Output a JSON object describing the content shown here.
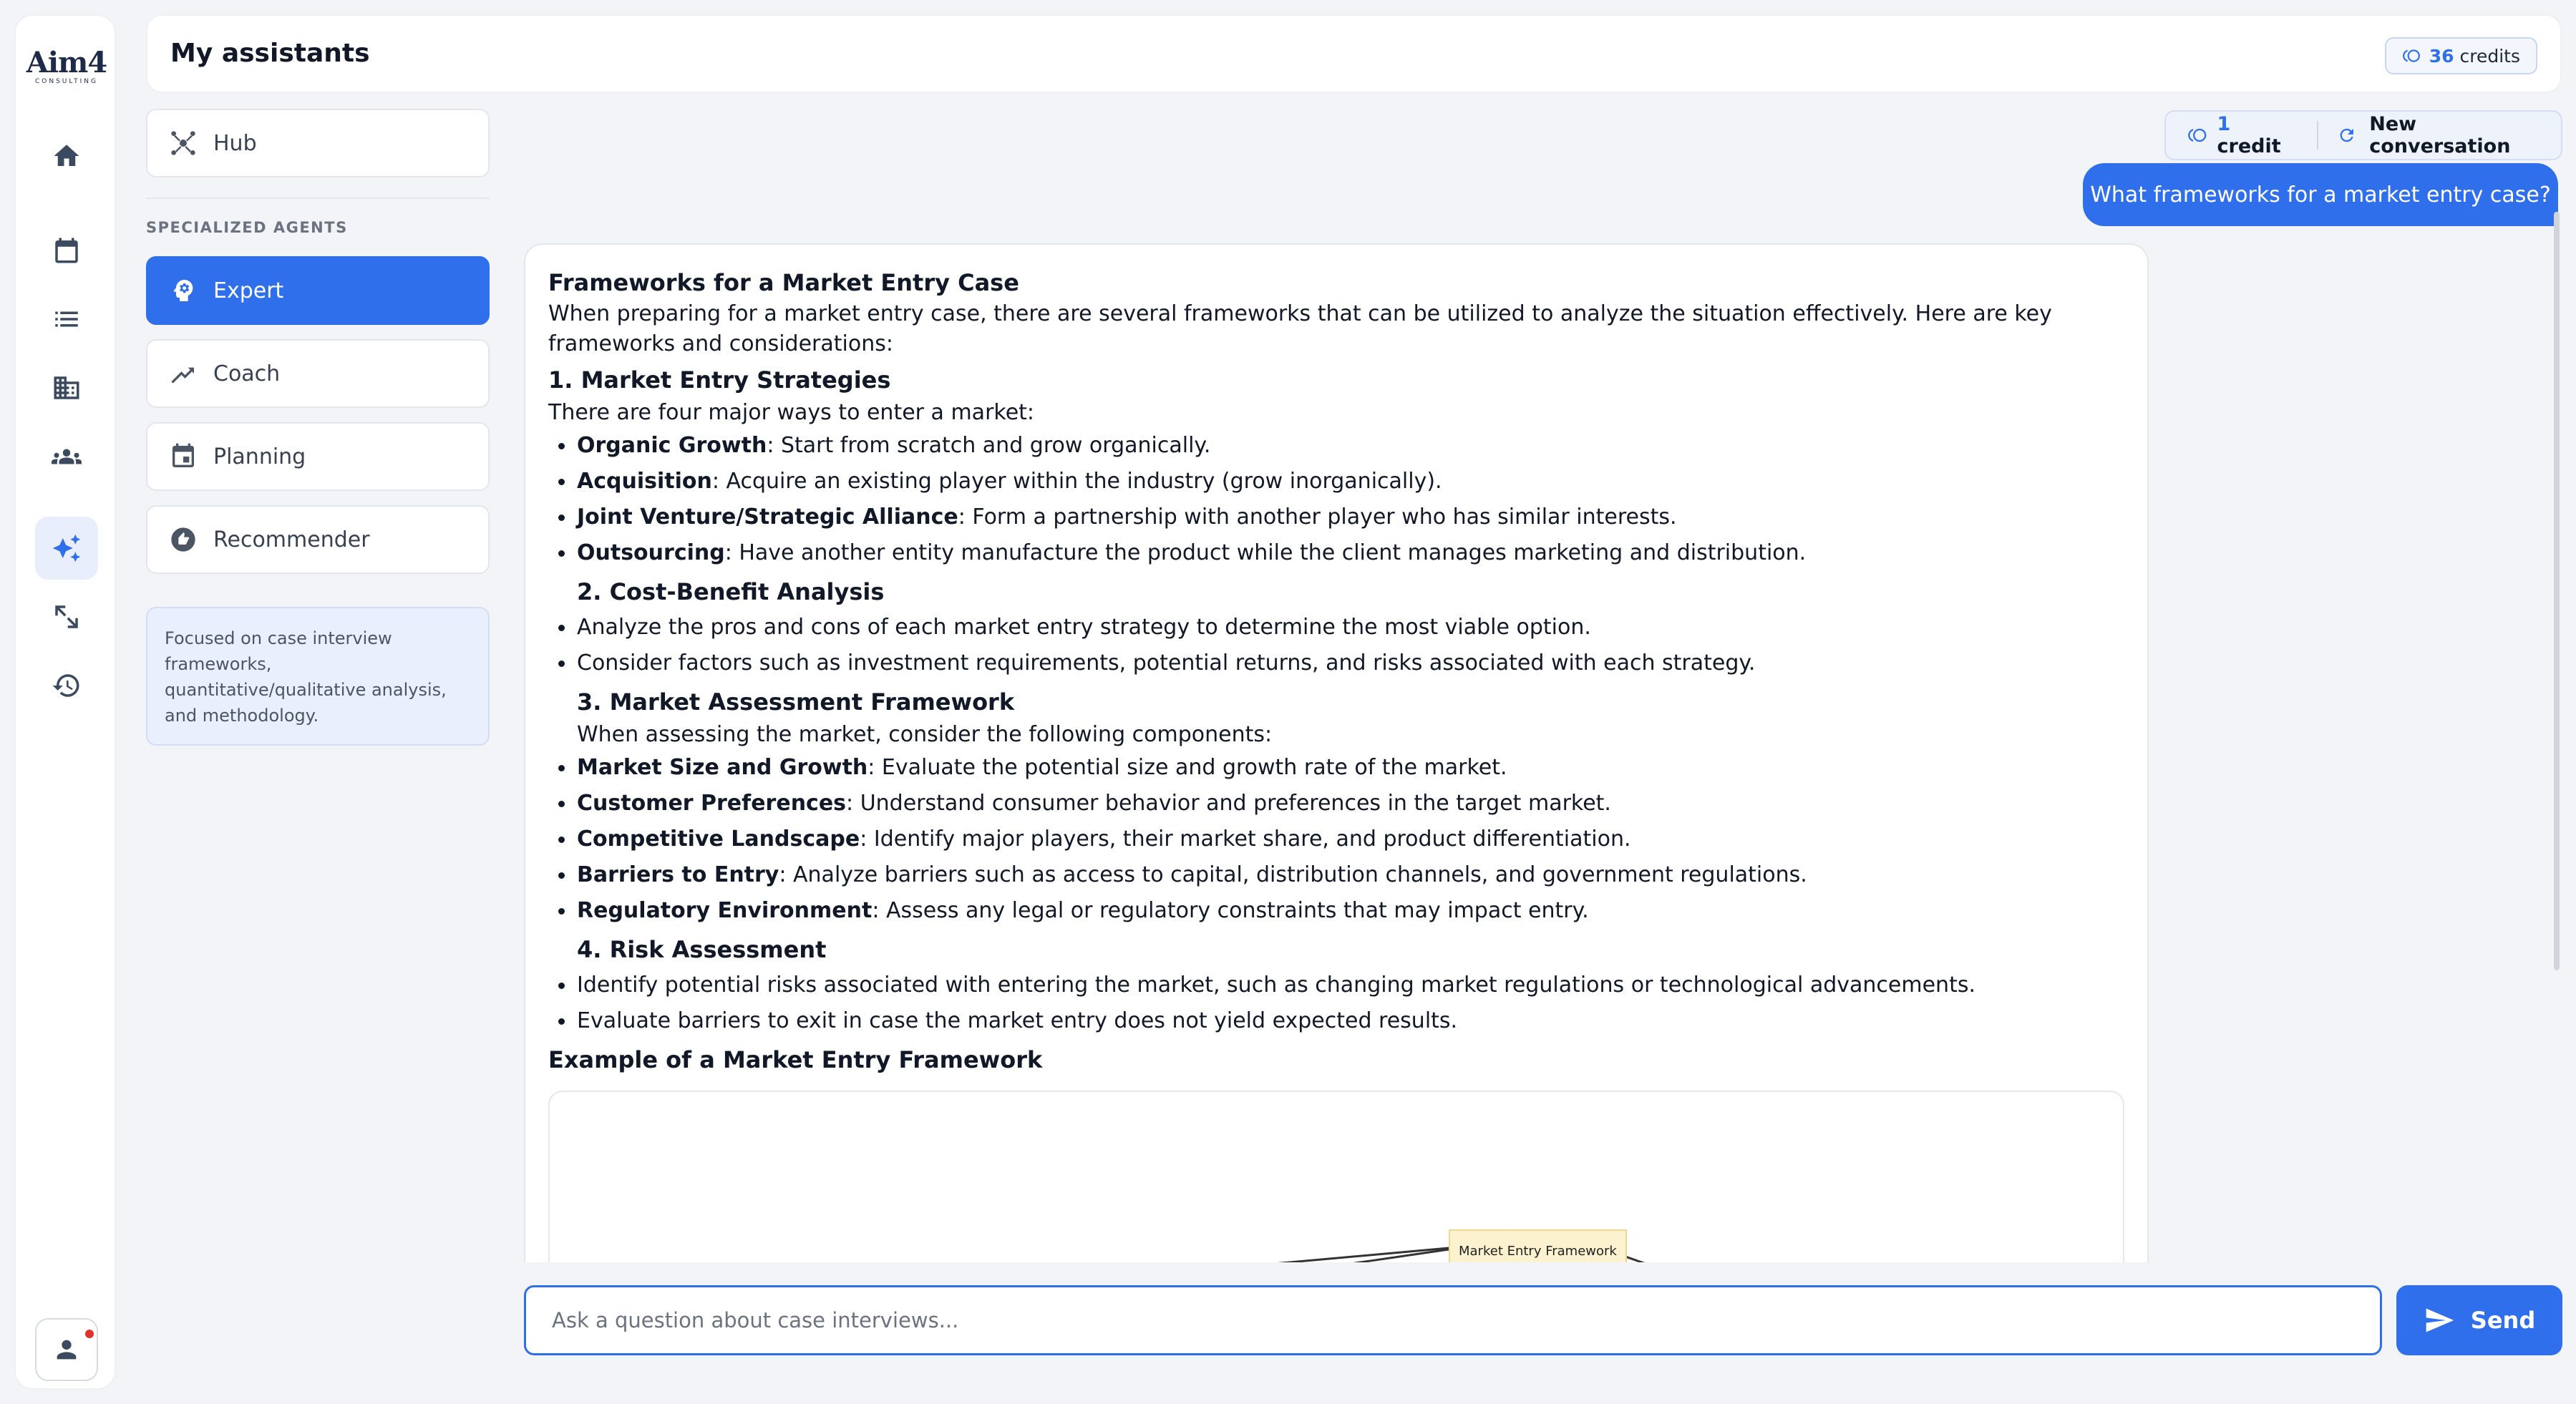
{
  "brand": {
    "logo_text": "Aim4",
    "logo_sub": "CONSULTING"
  },
  "header": {
    "title": "My assistants",
    "credits_value": "36",
    "credits_label": "credits"
  },
  "nav": {
    "items": [
      "home-icon",
      "calendar-icon",
      "list-icon",
      "building-icon",
      "people-icon",
      "sparkle-icon",
      "expand-icon",
      "history-icon"
    ],
    "active": "sparkle-icon"
  },
  "agents": {
    "hub_label": "Hub",
    "section_label": "SPECIALIZED AGENTS",
    "items": [
      {
        "label": "Expert",
        "active": true
      },
      {
        "label": "Coach",
        "active": false
      },
      {
        "label": "Planning",
        "active": false
      },
      {
        "label": "Recommender",
        "active": false
      }
    ],
    "description": "Focused on case interview frameworks, quantitative/qualitative analysis, and methodology."
  },
  "chat": {
    "credit_value": "1",
    "credit_label": "credit",
    "new_conversation": "New conversation",
    "user_message": "What frameworks for a market entry case?",
    "input_placeholder": "Ask a question about case interviews...",
    "send_label": "Send"
  },
  "response": {
    "title": "Frameworks for a Market Entry Case",
    "intro": "When preparing for a market entry case, there are several frameworks that can be utilized to analyze the situation effectively. Here are key frameworks and considerations:",
    "s1_title": "1. Market Entry Strategies",
    "s1_intro": "There are four major ways to enter a market:",
    "s1_items": [
      {
        "bold": "Organic Growth",
        "text": ": Start from scratch and grow organically."
      },
      {
        "bold": "Acquisition",
        "text": ": Acquire an existing player within the industry (grow inorganically)."
      },
      {
        "bold": "Joint Venture/Strategic Alliance",
        "text": ": Form a partnership with another player who has similar interests."
      },
      {
        "bold": "Outsourcing",
        "text": ": Have another entity manufacture the product while the client manages marketing and distribution."
      }
    ],
    "s2_title": "2. Cost-Benefit Analysis",
    "s2_items": [
      "Analyze the pros and cons of each market entry strategy to determine the most viable option.",
      "Consider factors such as investment requirements, potential returns, and risks associated with each strategy."
    ],
    "s3_title": "3. Market Assessment Framework",
    "s3_intro": "When assessing the market, consider the following components:",
    "s3_items": [
      {
        "bold": "Market Size and Growth",
        "text": ": Evaluate the potential size and growth rate of the market."
      },
      {
        "bold": "Customer Preferences",
        "text": ": Understand consumer behavior and preferences in the target market."
      },
      {
        "bold": "Competitive Landscape",
        "text": ": Identify major players, their market share, and product differentiation."
      },
      {
        "bold": "Barriers to Entry",
        "text": ": Analyze barriers such as access to capital, distribution channels, and government regulations."
      },
      {
        "bold": "Regulatory Environment",
        "text": ": Assess any legal or regulatory constraints that may impact entry."
      }
    ],
    "s4_title": "4. Risk Assessment",
    "s4_items": [
      "Identify potential risks associated with entering the market, such as changing market regulations or technological advancements.",
      "Evaluate barriers to exit in case the market entry does not yield expected results."
    ],
    "example_title": "Example of a Market Entry Framework",
    "diagram_root": "Market Entry Framework"
  },
  "colors": {
    "accent": "#2f6fec",
    "background": "#f3f4f8"
  }
}
